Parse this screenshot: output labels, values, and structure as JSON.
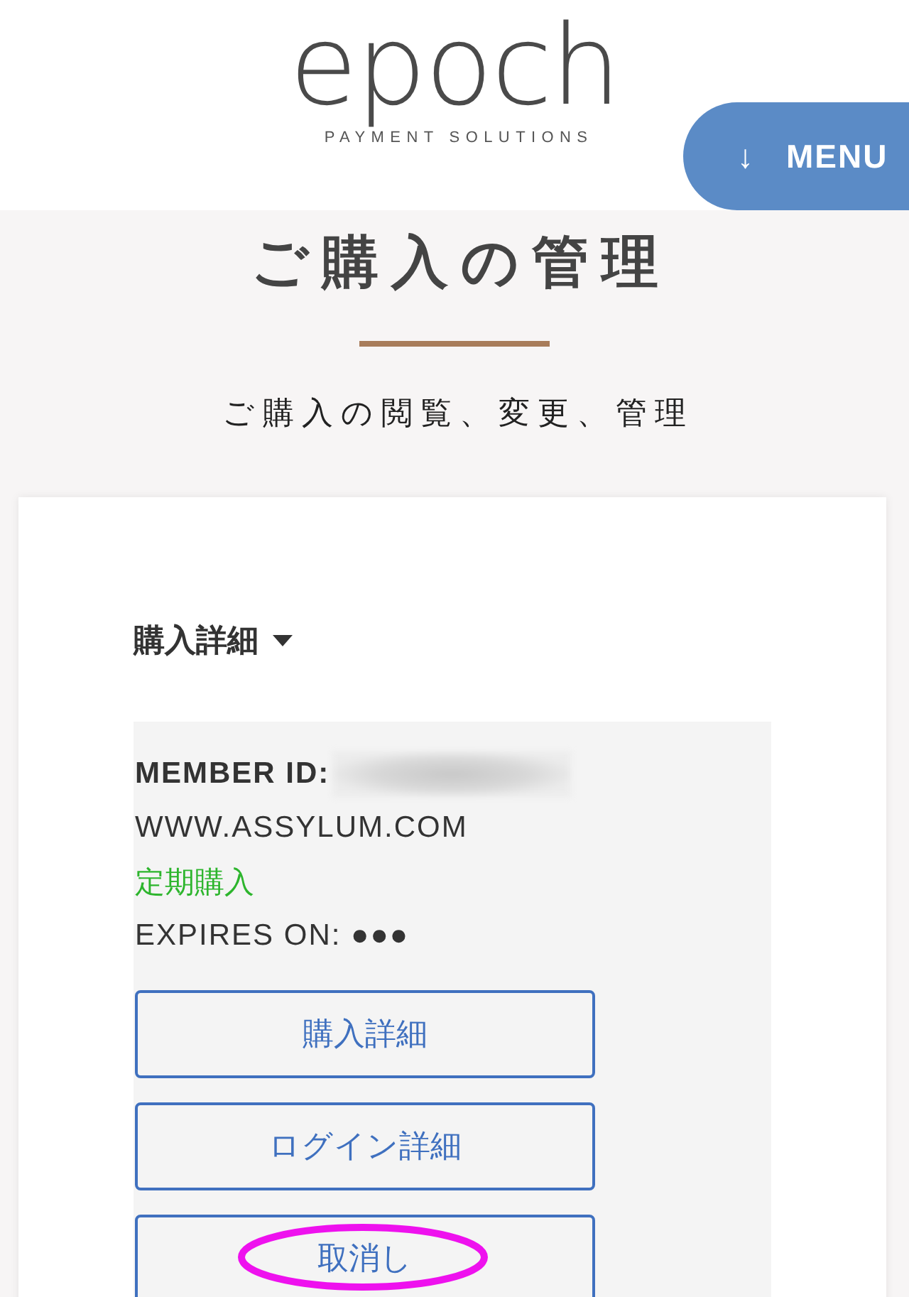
{
  "header": {
    "logo": "epoch",
    "tagline": "PAYMENT SOLUTIONS",
    "menu_button": {
      "glyph": "↓",
      "label": "MENU"
    }
  },
  "page": {
    "title": "ご購入の管理",
    "subtitle": "ご購入の閲覧、変更、管理"
  },
  "card": {
    "section_title": "購入詳細",
    "purchase": {
      "member_id_label": "MEMBER ID:",
      "site": "WWW.ASSYLUM.COM",
      "status": "定期購入",
      "expires": "EXPIRES ON: ●●●"
    },
    "buttons": [
      {
        "label": "購入詳細",
        "highlighted": false
      },
      {
        "label": "ログイン詳細",
        "highlighted": false
      },
      {
        "label": "取消し",
        "highlighted": true
      }
    ]
  }
}
